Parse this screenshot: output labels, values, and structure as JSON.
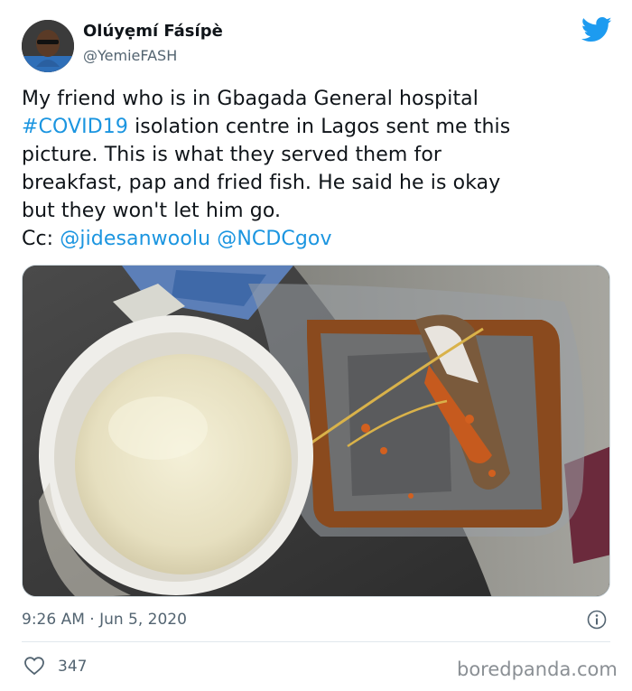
{
  "author": {
    "name": "Olúyẹmí Fásípè",
    "handle": "@YemieFASH",
    "avatar_icon": "user-avatar",
    "platform_icon": "twitter-bird-icon"
  },
  "tweet": {
    "line1": "My friend who is in Gbagada General hospital",
    "hashtag": "#COVID19",
    "line2_rest": " isolation centre in Lagos sent me this",
    "line3": "picture. This is what they served them for",
    "line4": "breakfast, pap and fried fish. He said he is okay",
    "line5": "but they won't let him go.",
    "cc_label": "Cc: ",
    "mention1": "@jidesanwoolu",
    "mention2": "@NCDCgov"
  },
  "footer": {
    "timestamp": "9:26 AM · Jun 5, 2020",
    "like_count": "347",
    "watermark": "boredpanda.com"
  },
  "colors": {
    "link": "#1b95e0",
    "twitter_blue": "#1d9bf0",
    "secondary_text": "#536471"
  }
}
